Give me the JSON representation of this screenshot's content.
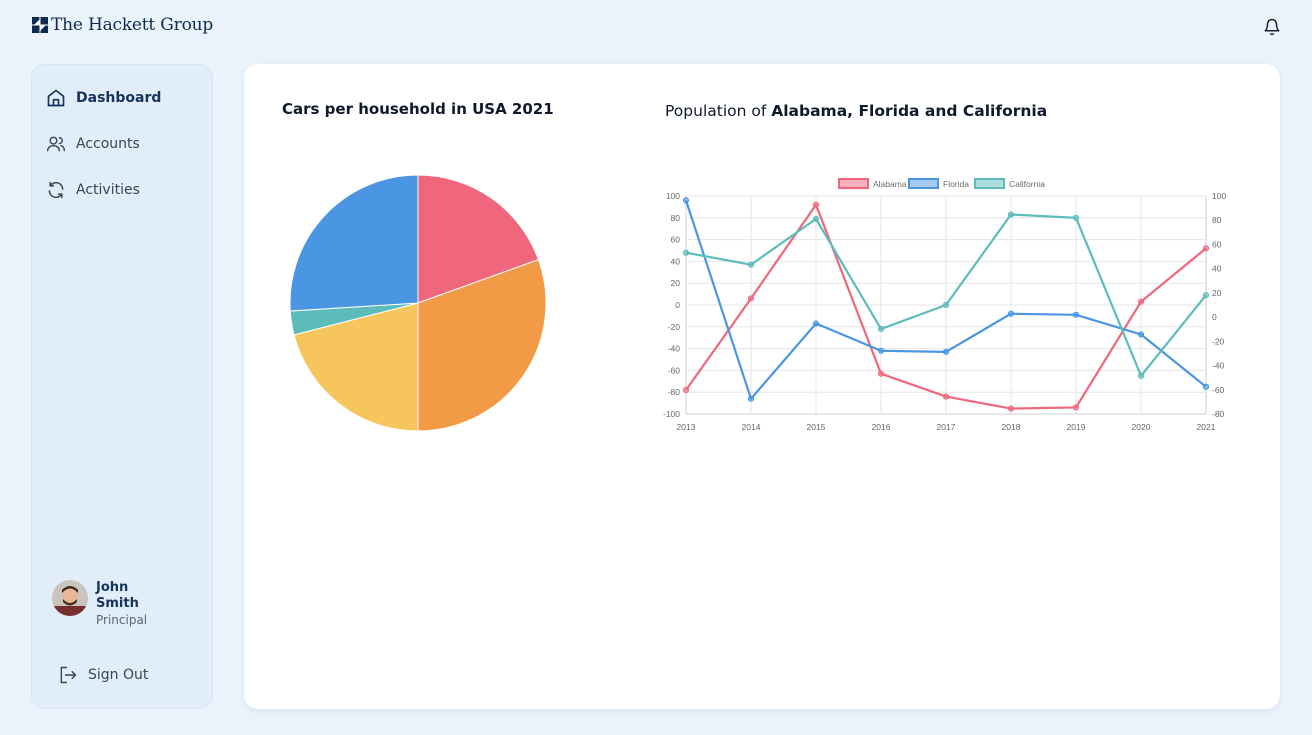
{
  "header": {
    "logo_text": "The Hackett Group",
    "logo_icon": "hackett-logo-icon",
    "notification_icon": "bell-icon"
  },
  "sidebar": {
    "items": [
      {
        "label": "Dashboard",
        "icon": "home-icon",
        "active": true
      },
      {
        "label": "Accounts",
        "icon": "users-icon",
        "active": false
      },
      {
        "label": "Activities",
        "icon": "refresh-icon",
        "active": false
      }
    ],
    "user": {
      "name": "John Smith",
      "role": "Principal"
    },
    "signout_label": "Sign Out"
  },
  "charts": {
    "pie_title": "Cars per household in USA 2021",
    "line_title_prefix": "Population of ",
    "line_title_bold": "Alabama, Florida and California"
  },
  "colors": {
    "pink": "#f0667c",
    "orange": "#f29a45",
    "yellow": "#f6c65c",
    "teal": "#5cbbbb",
    "blue": "#4a96e2",
    "accent": "#17335a"
  },
  "chart_data": [
    {
      "type": "pie",
      "title": "Cars per household in USA 2021",
      "slices": [
        {
          "color": "#f0667c",
          "percent": 19.5
        },
        {
          "color": "#f29a45",
          "percent": 30.5
        },
        {
          "color": "#f6c65c",
          "percent": 21.0
        },
        {
          "color": "#5cbbbb",
          "percent": 3.0
        },
        {
          "color": "#4a96e2",
          "percent": 26.0
        }
      ]
    },
    {
      "type": "line",
      "title": "Population of Alabama, Florida and California",
      "x": [
        "2013",
        "2014",
        "2015",
        "2016",
        "2017",
        "2018",
        "2019",
        "2020",
        "2021"
      ],
      "series": [
        {
          "name": "Alabama",
          "color": "#f0667c",
          "values": [
            -78,
            6,
            92,
            -63,
            -84,
            -95,
            -94,
            3,
            52
          ]
        },
        {
          "name": "Florida",
          "color": "#4a96e2",
          "values": [
            96,
            -86,
            -17,
            -42,
            -43,
            -8,
            -9,
            -27,
            -75
          ]
        },
        {
          "name": "California",
          "color": "#5cbbbb",
          "values": [
            48,
            37,
            79,
            -22,
            0,
            83,
            80,
            -65,
            9
          ]
        }
      ],
      "y_left_ticks": [
        "100",
        "80",
        "60",
        "40",
        "20",
        "0",
        "-20",
        "-40",
        "-60",
        "-80",
        "-100"
      ],
      "y_right_ticks": [
        "100",
        "80",
        "60",
        "40",
        "20",
        "0",
        "-20",
        "-40",
        "-60",
        "-80"
      ],
      "ylim_left": [
        -100,
        100
      ],
      "ylim_right": [
        -80,
        100
      ],
      "legend_position": "top-center",
      "grid": true
    }
  ]
}
